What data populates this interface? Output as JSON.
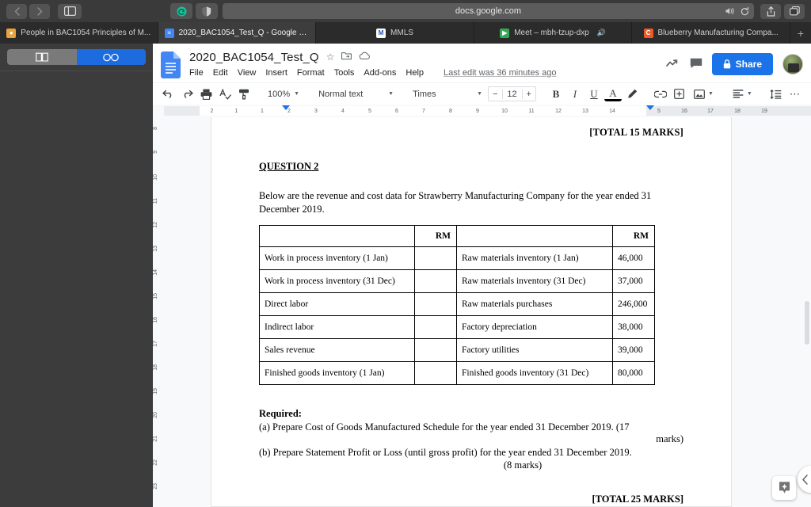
{
  "browser": {
    "back_icon": "chevron-left-icon",
    "forward_icon": "chevron-right-icon",
    "sidebar_icon": "sidebar-toggle-icon",
    "extension_icon": "grammarly-extension-icon",
    "shield_icon": "privacy-shield-icon",
    "url": "docs.google.com",
    "mute_icon": "speaker-icon",
    "reload_icon": "reload-icon",
    "share_icon": "share-upload-icon",
    "tabs_icon": "tab-overview-icon",
    "newtab_label": "+",
    "tabs": [
      {
        "label": "People in BAC1054 Principles of M...",
        "favicon": "people-icon",
        "favicon_color": "#e8a33d",
        "active": false,
        "audio": ""
      },
      {
        "label": "2020_BAC1054_Test_Q - Google D...",
        "favicon": "google-docs-icon",
        "favicon_color": "#4285f4",
        "active": true,
        "audio": ""
      },
      {
        "label": "MMLS",
        "favicon": "mmls-icon",
        "favicon_color": "#ffffff",
        "active": false,
        "audio": ""
      },
      {
        "label": "Meet – mbh-tzup-dxp",
        "favicon": "google-meet-icon",
        "favicon_color": "#34a853",
        "active": false,
        "audio": "speaker-icon"
      },
      {
        "label": "Blueberry Manufacturing Compa...",
        "favicon": "chegg-icon",
        "favicon_color": "#ee5a24",
        "active": false,
        "audio": ""
      }
    ]
  },
  "sidebar": {
    "segments": [
      {
        "icon": "bookmarks-book-icon",
        "selected": false
      },
      {
        "icon": "reading-list-glasses-icon",
        "selected": true
      }
    ],
    "accent": "#1c6ce0"
  },
  "docs": {
    "logo_icon": "google-docs-logo",
    "title": "2020_BAC1054_Test_Q",
    "title_icons": [
      {
        "name": "star-icon",
        "glyph": "☆"
      },
      {
        "name": "move-to-folder-icon",
        "glyph": "⇲"
      },
      {
        "name": "cloud-saved-icon",
        "glyph": "☁"
      }
    ],
    "menu": [
      "File",
      "Edit",
      "View",
      "Insert",
      "Format",
      "Tools",
      "Add-ons",
      "Help"
    ],
    "last_edit": "Last edit was 36 minutes ago",
    "activity_icon": "activity-trend-icon",
    "comments_icon": "comment-icon",
    "share_label": "Share",
    "share_lock_icon": "lock-icon",
    "share_color": "#1a73e8",
    "avatar_icon": "user-avatar",
    "toolbar": {
      "undo_icon": "undo-icon",
      "redo_icon": "redo-icon",
      "print_icon": "print-icon",
      "spellcheck_icon": "spellcheck-icon",
      "paint_format_icon": "paint-format-icon",
      "zoom_value": "100%",
      "style_value": "Normal text",
      "font_value": "Times",
      "font_size_decrease": "−",
      "font_size_value": "12",
      "font_size_increase": "+",
      "bold_label": "B",
      "italic_label": "I",
      "underline_label": "U",
      "text_color_label": "A",
      "highlight_icon": "highlight-pen-icon",
      "link_icon": "insert-link-icon",
      "comment_add_icon": "add-comment-icon",
      "image_icon": "insert-image-icon",
      "align_icon": "align-left-icon",
      "line_spacing_icon": "line-spacing-icon",
      "more_icon": "more-options-icon",
      "editing_mode_icon": "editing-pencil-icon",
      "collapse_icon": "collapse-toolbar-icon"
    },
    "outline_icon": "document-outline-icon",
    "explore_icon": "explore-icon",
    "side_panel_icon": "expand-side-panel-chevron",
    "horizontal_ruler": [
      "2",
      "1",
      "1",
      "2",
      "3",
      "4",
      "5",
      "6",
      "7",
      "8",
      "9",
      "10",
      "11",
      "12",
      "13",
      "14",
      "5",
      "16",
      "17",
      "18",
      "19"
    ],
    "vertical_ruler": [
      "8",
      "9",
      "10",
      "11",
      "12",
      "13",
      "14",
      "15",
      "16",
      "17",
      "18",
      "19",
      "20",
      "21",
      "22",
      "23"
    ]
  },
  "document": {
    "total_top": "[TOTAL 15 MARKS]",
    "question_heading": "QUESTION 2",
    "intro": "Below are the revenue and cost data for Strawberry Manufacturing Company for the year ended 31 December 2019.",
    "table": {
      "header": [
        "",
        "RM",
        "",
        "RM"
      ],
      "rows": [
        [
          "Work in process inventory (1 Jan)",
          "",
          "Raw materials inventory (1 Jan)",
          "46,000"
        ],
        [
          "Work in process inventory (31 Dec)",
          "",
          "Raw materials inventory (31 Dec)",
          "37,000"
        ],
        [
          "Direct labor",
          "",
          "Raw materials purchases",
          "246,000"
        ],
        [
          "Indirect labor",
          "",
          "Factory depreciation",
          "38,000"
        ],
        [
          "Sales revenue",
          "",
          "Factory utilities",
          "39,000"
        ],
        [
          "Finished goods inventory (1 Jan)",
          "",
          "Finished goods inventory (31 Dec)",
          "80,000"
        ]
      ]
    },
    "required_heading": "Required:",
    "required_a": "(a) Prepare Cost of Goods Manufactured Schedule for the year ended 31 December 2019.  (17",
    "required_a_marks": "marks)",
    "required_b": "(b) Prepare Statement Profit or Loss (until gross profit) for the year ended 31 December 2019.",
    "required_b_marks": "(8 marks)",
    "total_bottom": "[TOTAL 25 MARKS]"
  }
}
